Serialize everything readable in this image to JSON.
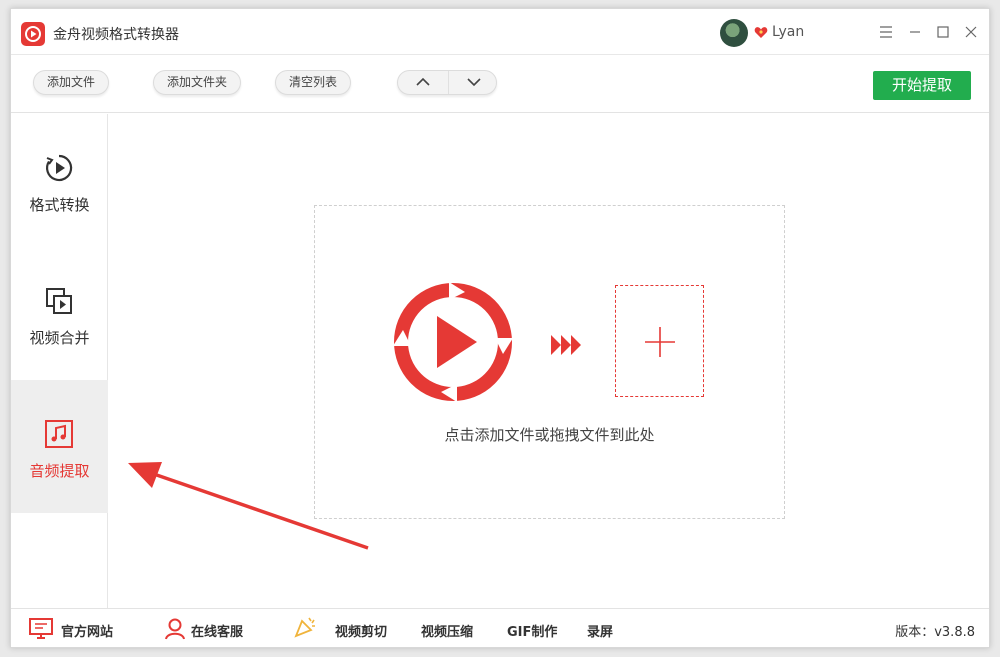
{
  "app": {
    "title": "金舟视频格式转换器"
  },
  "user": {
    "name": "Lyan"
  },
  "toolbar": {
    "add_file": "添加文件",
    "add_folder": "添加文件夹",
    "clear_list": "清空列表",
    "start": "开始提取"
  },
  "sidebar": {
    "items": [
      {
        "label": "格式转换",
        "icon": "play-circle-icon",
        "active": false
      },
      {
        "label": "视频合并",
        "icon": "merge-icon",
        "active": false
      },
      {
        "label": "音频提取",
        "icon": "music-note-icon",
        "active": true
      }
    ]
  },
  "main": {
    "hint": "点击添加文件或拖拽文件到此处"
  },
  "statusbar": {
    "website": "官方网站",
    "service": "在线客服",
    "video_cut": "视频剪切",
    "video_compress": "视频压缩",
    "gif": "GIF制作",
    "record": "录屏",
    "version": "版本：v3.8.8"
  },
  "colors": {
    "accent": "#e53935",
    "start_button": "#22ad4e",
    "active_bg": "#eeeeee"
  }
}
